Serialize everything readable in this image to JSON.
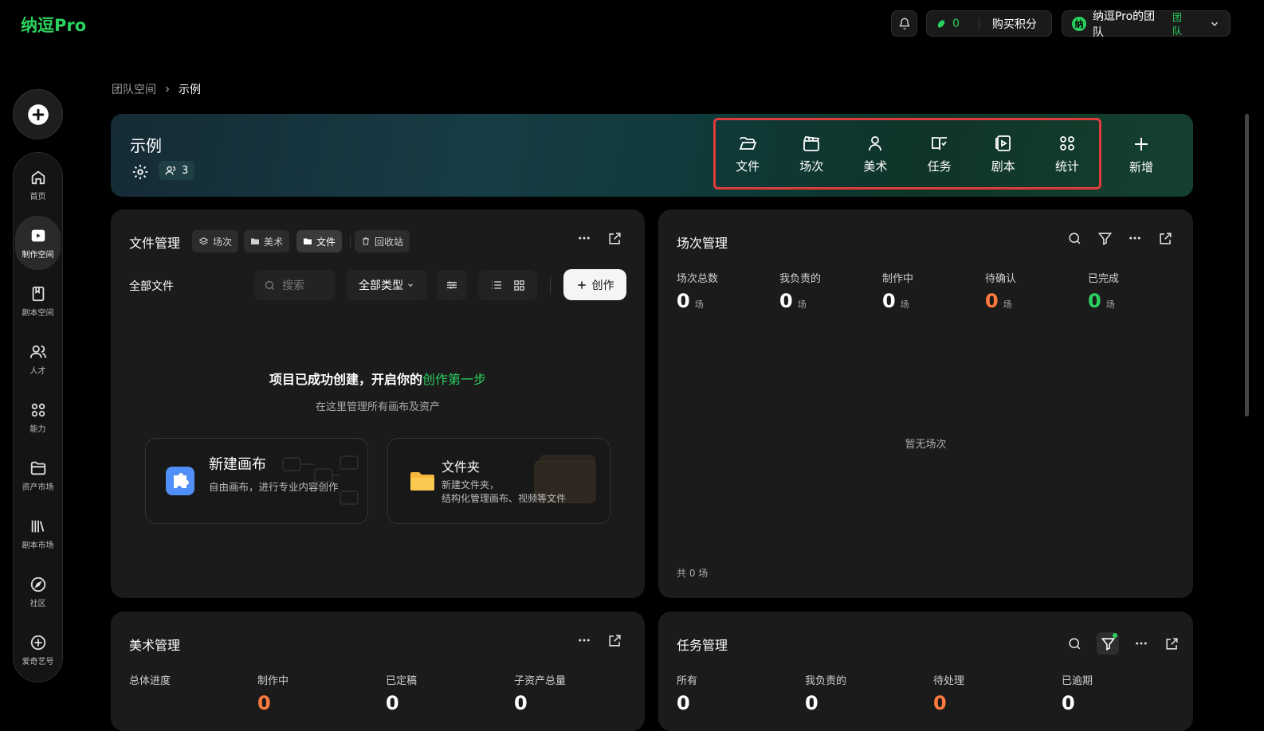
{
  "brand": {
    "logo": "纳逗Pro"
  },
  "topbar": {
    "points_value": "0",
    "buy_points": "购买积分",
    "team_avatar": "纳",
    "team_name": "纳逗Pro的团队",
    "team_tag": "团队"
  },
  "sidebar": {
    "items": [
      {
        "label": "首页",
        "icon": "home-icon"
      },
      {
        "label": "制作空间",
        "icon": "clapper-icon",
        "active": true
      },
      {
        "label": "剧本空间",
        "icon": "book-icon"
      },
      {
        "label": "人才",
        "icon": "people-icon"
      },
      {
        "label": "能力",
        "icon": "apps-icon"
      },
      {
        "label": "资产市场",
        "icon": "folder-icon"
      },
      {
        "label": "剧本市场",
        "icon": "library-icon"
      },
      {
        "label": "社区",
        "icon": "compass-icon"
      },
      {
        "label": "爱奇艺号",
        "icon": "plus-circle-icon"
      }
    ]
  },
  "breadcrumb": {
    "root": "团队空间",
    "current": "示例"
  },
  "hero": {
    "title": "示例",
    "member_count": "3",
    "actions": [
      {
        "label": "文件",
        "icon": "folder-open-icon"
      },
      {
        "label": "场次",
        "icon": "clapper-icon"
      },
      {
        "label": "美术",
        "icon": "person-icon"
      },
      {
        "label": "任务",
        "icon": "book-check-icon"
      },
      {
        "label": "剧本",
        "icon": "play-book-icon"
      },
      {
        "label": "统计",
        "icon": "grid-icon"
      }
    ],
    "add_label": "新增"
  },
  "file_panel": {
    "title": "文件管理",
    "chips": [
      {
        "label": "场次"
      },
      {
        "label": "美术"
      },
      {
        "label": "文件",
        "active": true
      },
      {
        "label": "回收站"
      }
    ],
    "all_files": "全部文件",
    "search_placeholder": "搜索",
    "type_select": "全部类型",
    "create_label": "创作",
    "empty_title": "项目已成功创建，开启你的",
    "empty_title_highlight": "创作第一步",
    "empty_sub": "在这里管理所有画布及资产",
    "card_canvas": {
      "title": "新建画布",
      "desc": "自由画布，进行专业内容创作"
    },
    "card_folder": {
      "title": "文件夹",
      "desc1": "新建文件夹，",
      "desc2": "结构化管理画布、视频等文件"
    }
  },
  "scene_panel": {
    "title": "场次管理",
    "stats": [
      {
        "label": "场次总数",
        "value": "0",
        "unit": "场",
        "color": "#ffffff"
      },
      {
        "label": "我负责的",
        "value": "0",
        "unit": "场",
        "color": "#ffffff"
      },
      {
        "label": "制作中",
        "value": "0",
        "unit": "场",
        "color": "#ffffff"
      },
      {
        "label": "待确认",
        "value": "0",
        "unit": "场",
        "color": "#ff7a3d"
      },
      {
        "label": "已完成",
        "value": "0",
        "unit": "场",
        "color": "#2bd15f"
      }
    ],
    "empty": "暂无场次",
    "total": "共 0 场"
  },
  "art_panel": {
    "title": "美术管理",
    "stats": [
      {
        "label": "总体进度"
      },
      {
        "label": "制作中",
        "value": "0",
        "color": "#ff7a3d"
      },
      {
        "label": "已定稿",
        "value": "0",
        "color": "#ffffff"
      },
      {
        "label": "子资产总量",
        "value": "0",
        "color": "#ffffff"
      }
    ]
  },
  "task_panel": {
    "title": "任务管理",
    "stats": [
      {
        "label": "所有",
        "value": "0",
        "color": "#ffffff"
      },
      {
        "label": "我负责的",
        "value": "0",
        "color": "#ffffff"
      },
      {
        "label": "待处理",
        "value": "0",
        "color": "#ff7a3d"
      },
      {
        "label": "已逾期",
        "value": "0",
        "color": "#ffffff"
      }
    ]
  }
}
